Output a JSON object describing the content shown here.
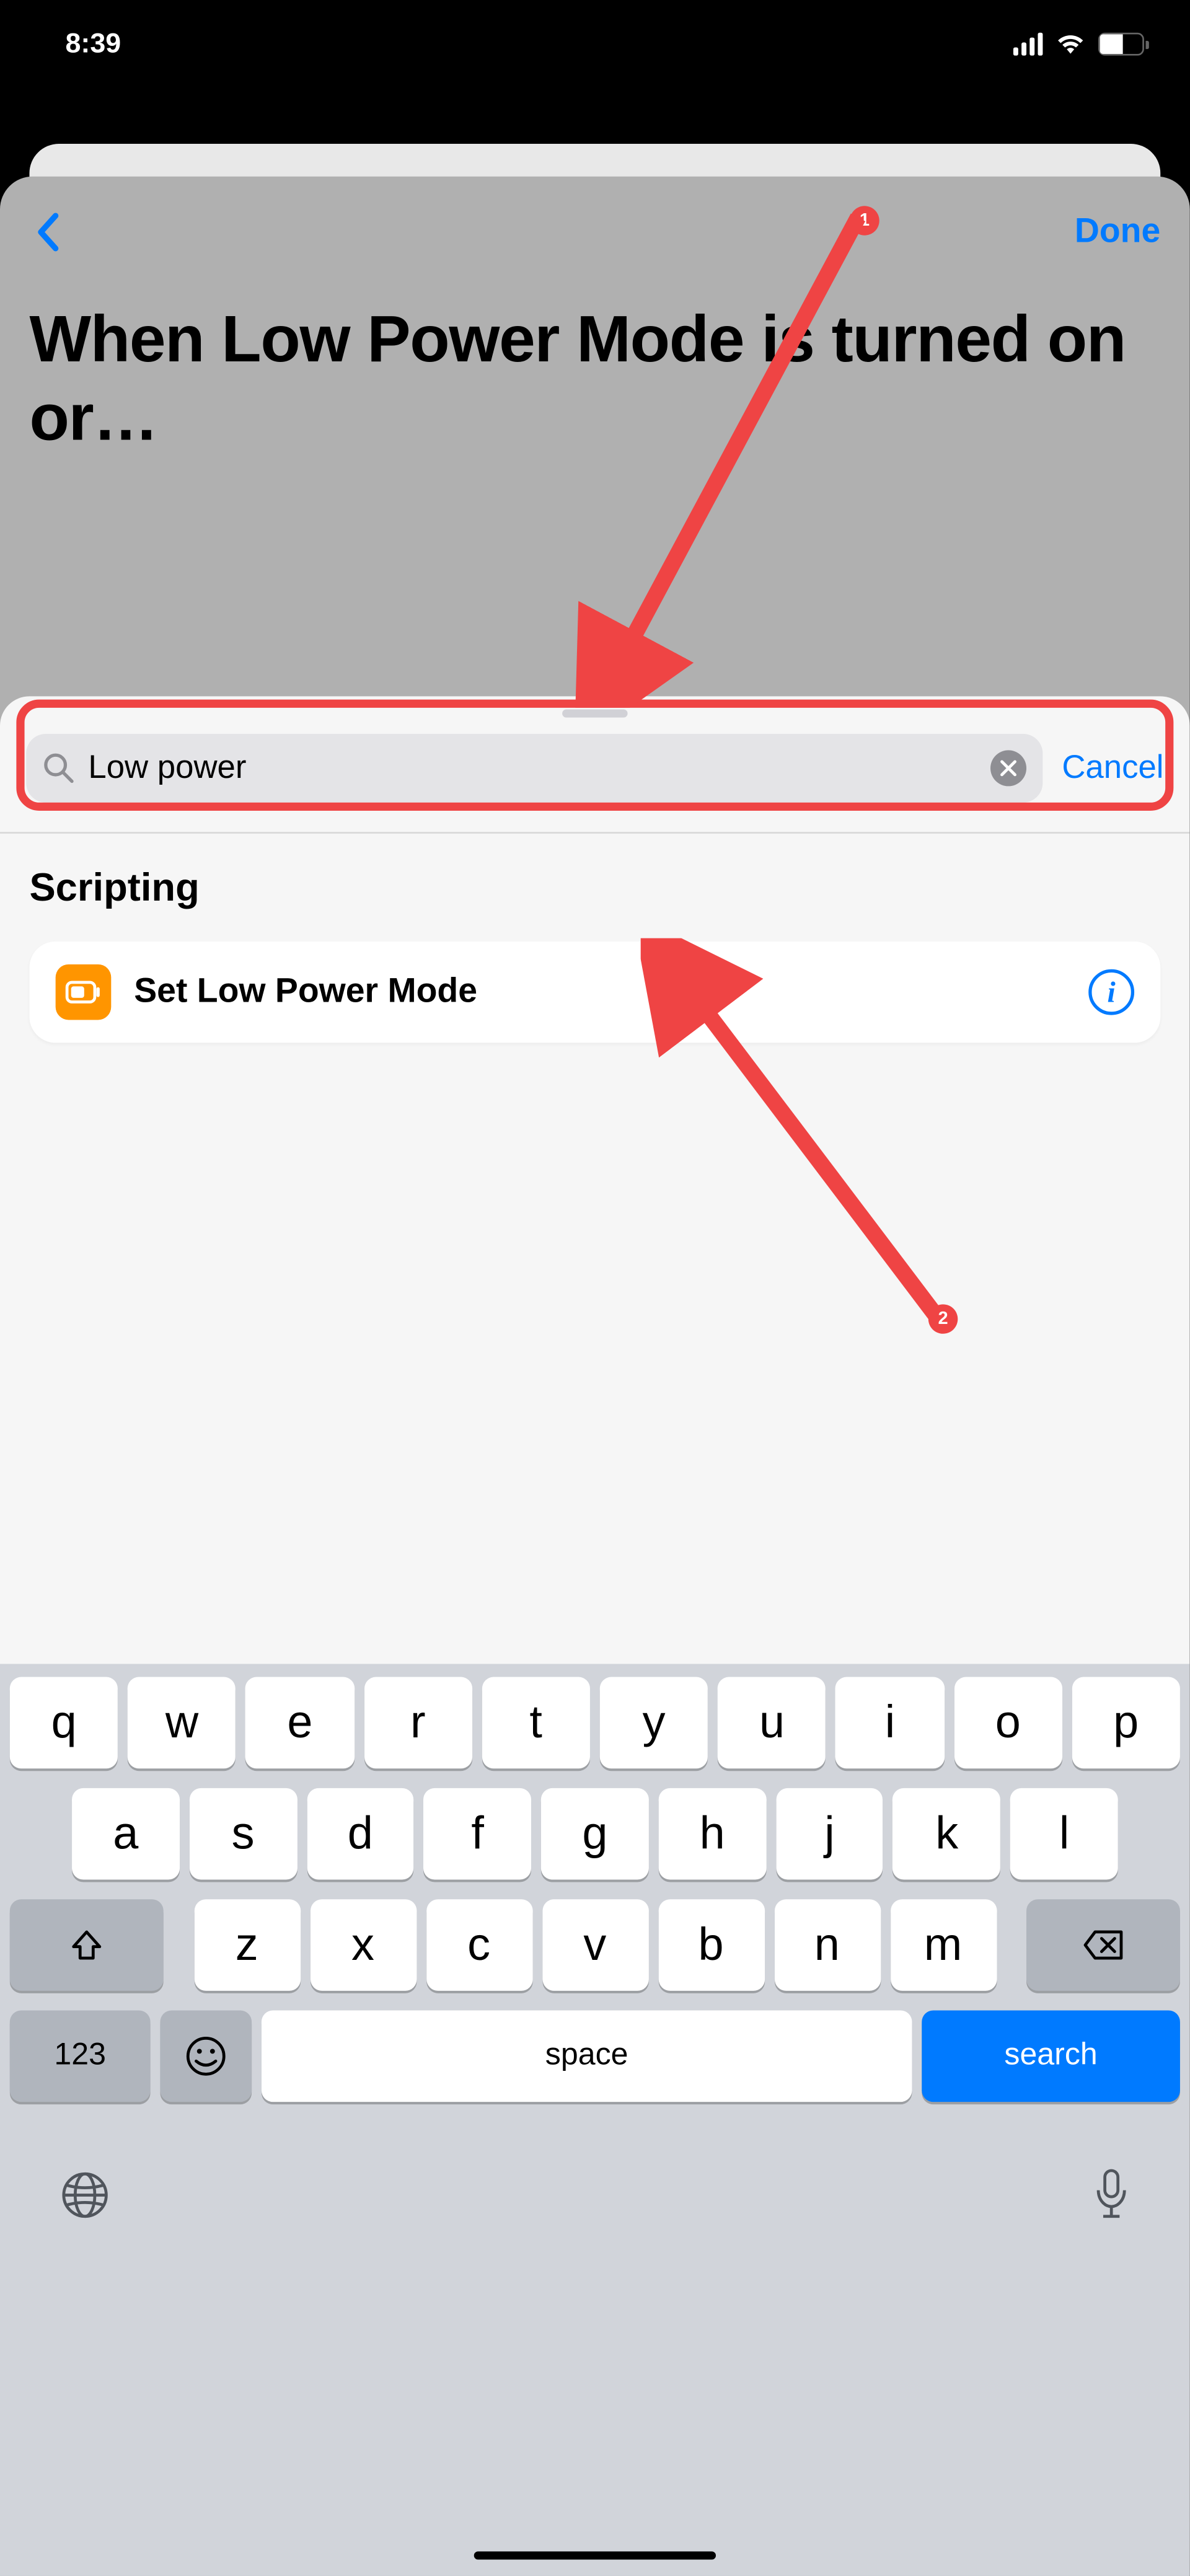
{
  "status": {
    "time": "8:39",
    "battery_percent": "54"
  },
  "nav": {
    "done": "Done"
  },
  "title": "When Low Power Mode is turned on or…",
  "search": {
    "value": "Low power",
    "cancel": "Cancel"
  },
  "section": {
    "header": "Scripting",
    "action": {
      "label": "Set Low Power Mode"
    }
  },
  "annotations": {
    "arrow1": "1",
    "arrow2": "2"
  },
  "keyboard": {
    "row1": [
      "q",
      "w",
      "e",
      "r",
      "t",
      "y",
      "u",
      "i",
      "o",
      "p"
    ],
    "row2": [
      "a",
      "s",
      "d",
      "f",
      "g",
      "h",
      "j",
      "k",
      "l"
    ],
    "row3": [
      "z",
      "x",
      "c",
      "v",
      "b",
      "n",
      "m"
    ],
    "key_123": "123",
    "key_space": "space",
    "key_search": "search"
  }
}
